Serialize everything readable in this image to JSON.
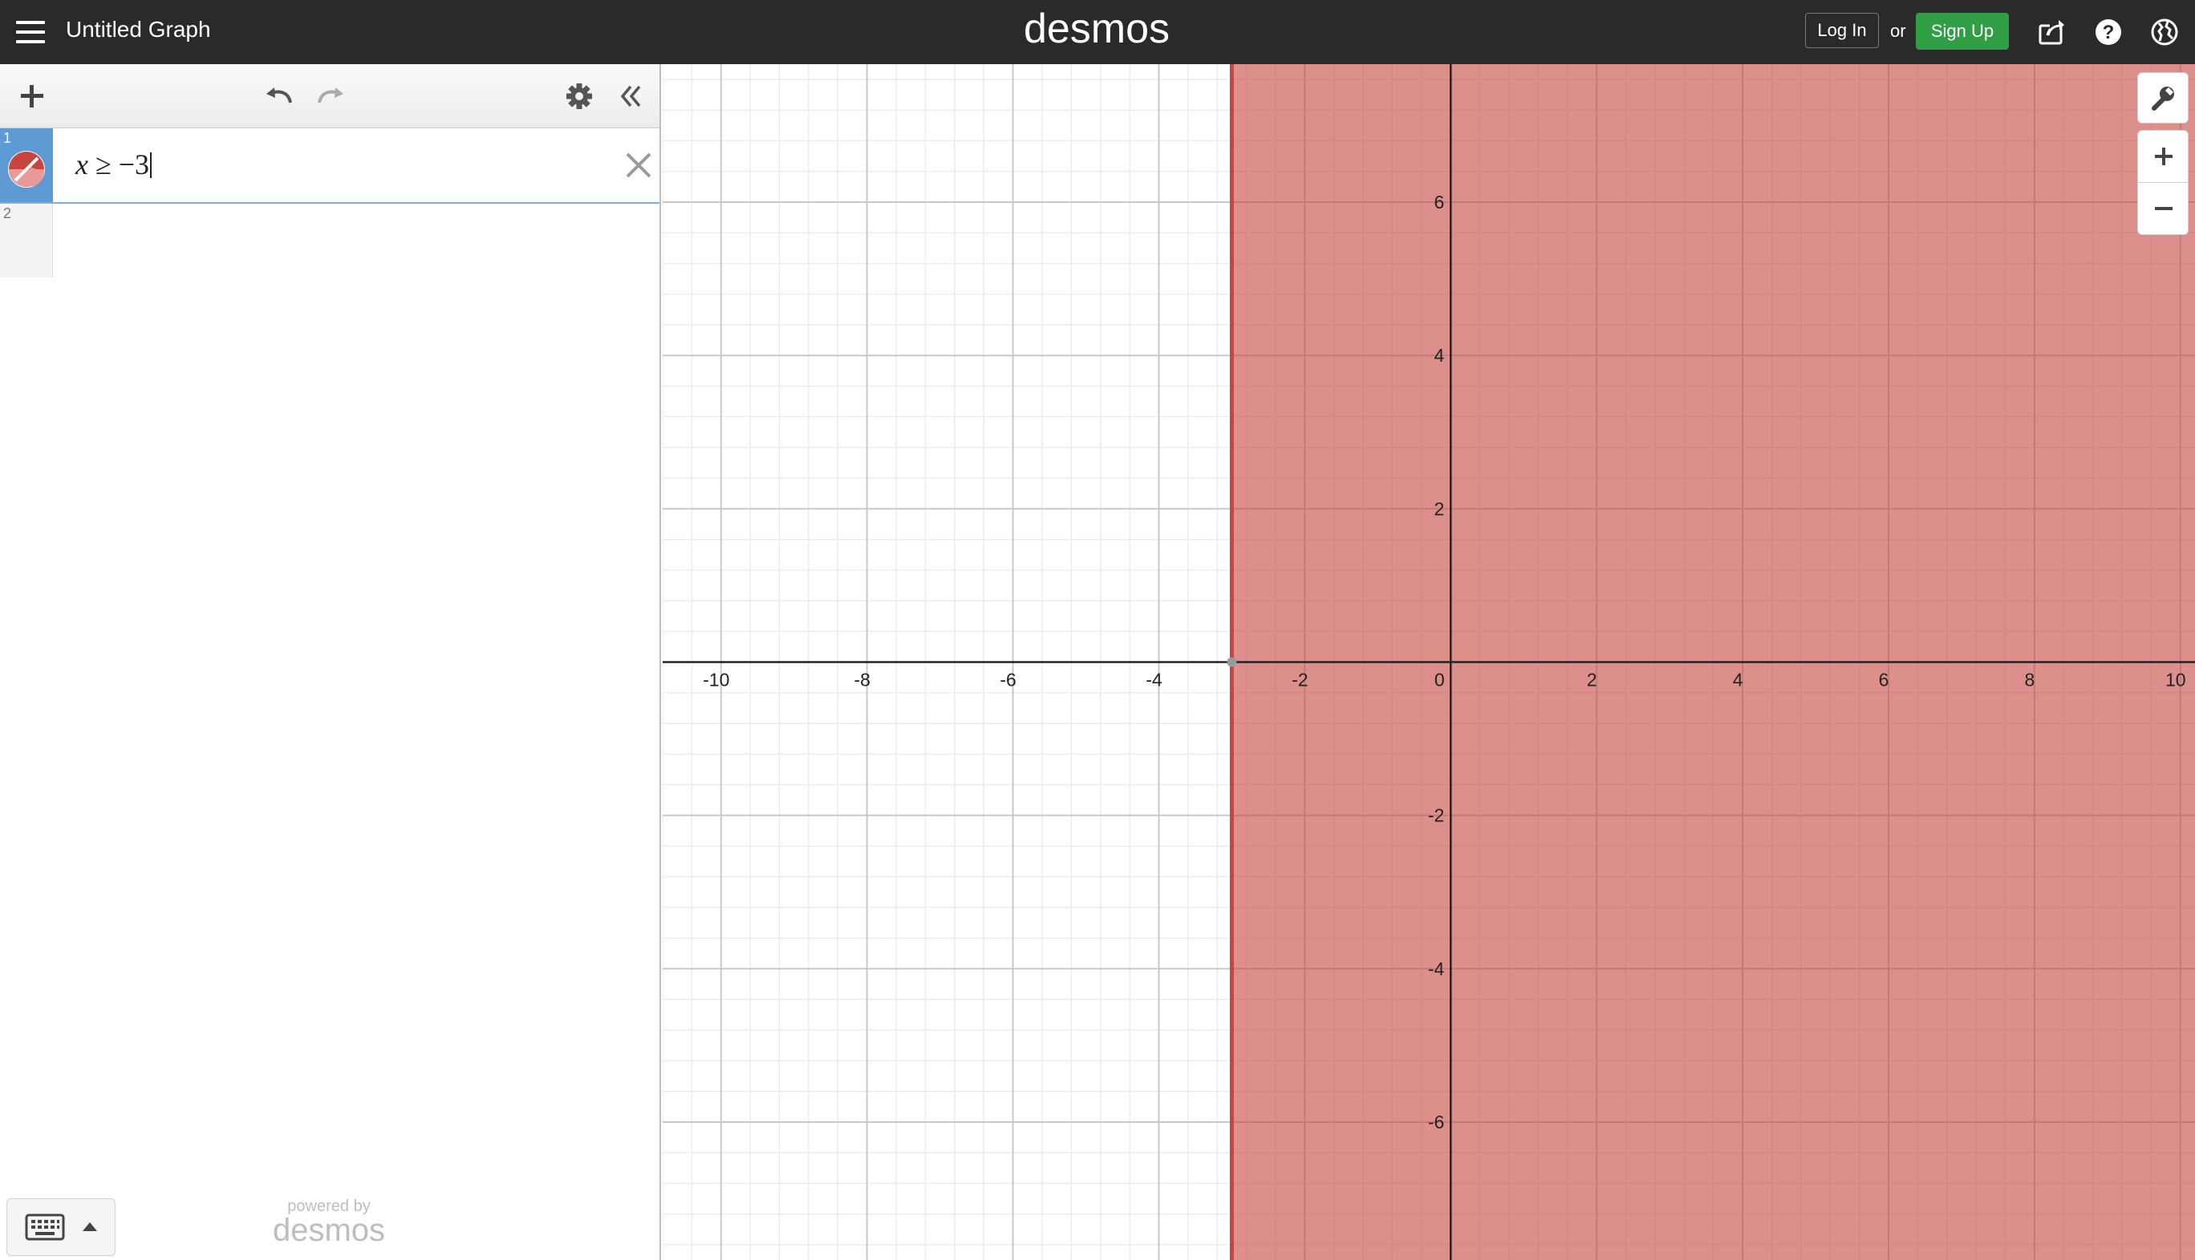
{
  "app": {
    "title": "Untitled Graph",
    "brand": "desmos",
    "login_label": "Log In",
    "or_text": "or",
    "signup_label": "Sign Up"
  },
  "header_icons": [
    "hamburger-menu-icon",
    "share-icon",
    "help-icon",
    "language-globe-icon"
  ],
  "expression_toolbar": {
    "icons": [
      "add-icon",
      "undo-icon",
      "redo-icon",
      "settings-gear-icon",
      "collapse-panel-icon"
    ]
  },
  "expressions": [
    {
      "index": "1",
      "latex_display": {
        "var": "x",
        "op": " ≥ ",
        "value": "−3"
      },
      "color": "#c74440",
      "active": true
    },
    {
      "index": "2",
      "latex_display": null,
      "active": false
    }
  ],
  "footer": {
    "powered_by": "powered by",
    "brand": "desmos",
    "keypad_icons": [
      "keyboard-icon",
      "caret-up-icon"
    ]
  },
  "graph": {
    "x_range": [
      -10.8,
      10.2
    ],
    "y_range": [
      -7.8,
      7.8
    ],
    "x_ticks": [
      "-10",
      "-8",
      "-6",
      "-4",
      "-2",
      "0",
      "2",
      "4",
      "6",
      "8",
      "10"
    ],
    "y_ticks": [
      "6",
      "4",
      "2",
      "-2",
      "-4",
      "-6"
    ],
    "major_step": 2,
    "minor_step": 0.4,
    "shaded_region": {
      "inequality": "x ≥ -3",
      "boundary_x": -3,
      "fill_color": "#c74440",
      "fill_opacity": 0.6
    },
    "controls": [
      "wrench-settings-icon",
      "zoom-in-icon",
      "zoom-out-icon"
    ]
  },
  "colors": {
    "topbar": "#2a2a2a",
    "signup_green": "#2f9e44",
    "active_row_tab": "#5e9ad4",
    "expression_red": "#c74440"
  }
}
